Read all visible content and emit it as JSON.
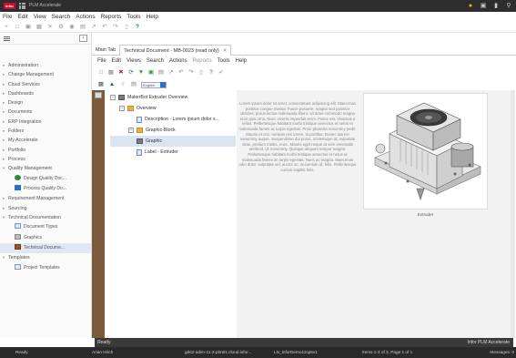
{
  "app": {
    "logo_text": "infor",
    "title": "PLM Accelerate"
  },
  "top_icons": [
    "user-icon",
    "message-icon",
    "bookmark-icon",
    "search-icon"
  ],
  "menubar": [
    "File",
    "Edit",
    "View",
    "Search",
    "Actions",
    "Reports",
    "Tools",
    "Help"
  ],
  "sidebar": {
    "items": [
      {
        "label": "Administration"
      },
      {
        "label": "Change Management"
      },
      {
        "label": "Cloud Services"
      },
      {
        "label": "Dashboards"
      },
      {
        "label": "Design"
      },
      {
        "label": "Documents"
      },
      {
        "label": "ERP Integration"
      },
      {
        "label": "Folders"
      },
      {
        "label": "My Accelerate"
      },
      {
        "label": "Portfolio"
      },
      {
        "label": "Process"
      },
      {
        "label": "Quality Management"
      }
    ],
    "qm_children": [
      {
        "label": "Design Quality Doc..."
      },
      {
        "label": "Process Quality Do..."
      }
    ],
    "items2": [
      {
        "label": "Requirement Management"
      },
      {
        "label": "Sourcing"
      },
      {
        "label": "Technical Documentation"
      }
    ],
    "td_children": [
      {
        "label": "Document Types"
      },
      {
        "label": "Graphics"
      },
      {
        "label": "Technical Docume..."
      }
    ],
    "items3": [
      {
        "label": "Templates"
      }
    ],
    "tmpl_children": [
      {
        "label": "Project Templates"
      }
    ]
  },
  "tabs": [
    {
      "label": "Main Tab"
    },
    {
      "label": "Technical Document - MB-0023 (read only)"
    }
  ],
  "doc_menubar": [
    "File",
    "Edit",
    "Views",
    "Search",
    "Actions",
    "Reports",
    "Tools",
    "Help"
  ],
  "toolbar3": {
    "dropdown_text": "English"
  },
  "tree": {
    "root": "MakerBot Extruder Overview",
    "overview": "Overview",
    "description": "Description - Lorem ipsum dolor s...",
    "graphic_block": "Graphic-Block",
    "graphic": "Graphic",
    "label": "Label - Extruder"
  },
  "preview": {
    "lorem": "Lorem ipsum dolor sit amet, consectetuer adipiscing elit. Maecenas porttitor congue massa. Fusce posuere, magna sed pulvinar ultricies, purus lectus malesuada libero, sit amet commodo magna eros quis urna. Nunc viverra imperdiet enim. Fusce est. Vivamus a tellus. Pellentesque habitant morbi tristique senectus et netus et malesuada fames ac turpis egestas. Proin pharetra nonummy pede. Mauris et orci. Aenean nec lorem. In porttitor. Donec laoreet nonummy augue. Suspendisse dui purus, scelerisque at, vulputate vitae, pretium mattis, nunc. Mauris eget neque at sem venenatis eleifend. Ut nonummy. Quisque aliquam tempor magna. Pellentesque habitant morbi tristique senectus et netus et malesuada fames ac turpis egestas. Nunc ac magna. Maecenas odio dolor, vulputate vel, auctor ac, accumsan id, felis. Pellentesque cursus sagittis felis.",
    "caption": "Extruder"
  },
  "status1": {
    "left": "Ready",
    "right": "Infor PLM Accelerate"
  },
  "status2": {
    "ready": "Ready",
    "user": "Arian Hirch",
    "server": "gds2-adim-11-2-plm01.cloud.infor...",
    "db": "LN_InforDemo11sp5v1",
    "items": "Items 1-3 of 3, Page 1 of 1",
    "messages": "Messages: 0"
  }
}
